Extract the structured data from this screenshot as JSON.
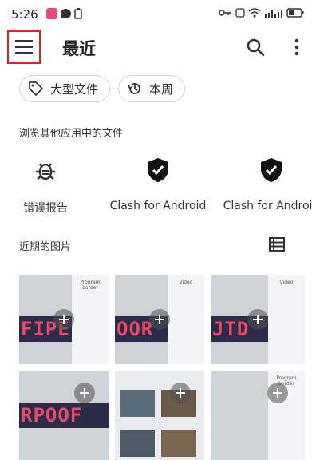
{
  "status_bar": {
    "time": "5:26"
  },
  "header": {
    "title": "最近"
  },
  "chips": [
    {
      "label": "大型文件",
      "icon": "tag-icon"
    },
    {
      "label": "本周",
      "icon": "history-icon"
    }
  ],
  "browse_section": {
    "title": "浏览其他应用中的文件",
    "apps": [
      {
        "label": "错误报告",
        "icon": "bug-icon"
      },
      {
        "label": "Clash for Android",
        "icon": "shield-check-icon"
      },
      {
        "label": "Clash for Android",
        "icon": "shield-check-icon"
      }
    ]
  },
  "recent_images": {
    "title": "近期的图片",
    "items": [
      {
        "led": "FIPE",
        "panel_title": "Program border"
      },
      {
        "led": "OOR",
        "panel_title": "Video"
      },
      {
        "led": "JTD",
        "panel_title": "Video"
      },
      {
        "led": "RPOOF",
        "panel_title": ""
      },
      {
        "led": "",
        "panel_title": ""
      },
      {
        "led": "",
        "panel_title": "Program border"
      }
    ]
  },
  "colors": {
    "accent_red": "#e02020",
    "chip_border": "#cfd3d8"
  }
}
